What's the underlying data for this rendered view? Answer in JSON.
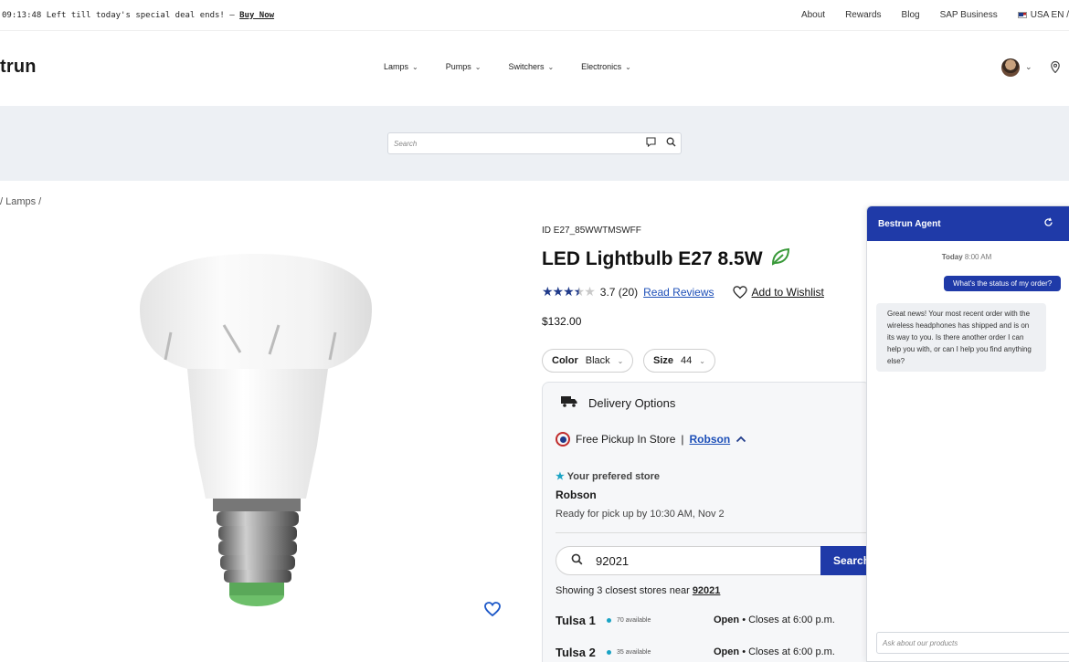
{
  "topbar": {
    "countdown": "09:13:48",
    "promo_text": "Left till today's special deal ends! —",
    "promo_link": "Buy Now",
    "links": [
      "About",
      "Rewards",
      "Blog",
      "SAP Business"
    ],
    "locale": "USA EN /"
  },
  "header": {
    "logo": "trun",
    "nav": [
      "Lamps",
      "Pumps",
      "Switchers",
      "Electronics"
    ]
  },
  "search": {
    "placeholder": "Search"
  },
  "breadcrumb": "/ Lamps /",
  "product": {
    "id_label": "ID E27_85WWTMSWFF",
    "title": "LED Lightbulb E27 8.5W",
    "rating_value": 3.7,
    "rating_text": "3.7 (20)",
    "read_reviews": "Read Reviews",
    "wishlist": "Add to Wishlist",
    "price": "$132.00",
    "color_label": "Color",
    "color_value": "Black",
    "size_label": "Size",
    "size_value": "44"
  },
  "delivery": {
    "title": "Delivery Options",
    "pickup_label": "Free Pickup In Store",
    "pickup_store": "Robson",
    "preferred_label": "Your prefered store",
    "preferred_name": "Robson",
    "ready_text": "Ready for pick up by 10:30 AM, Nov 2",
    "zip_value": "92021",
    "search_button": "Search",
    "showing_prefix": "Showing 3 closest stores near",
    "showing_zip": "92021",
    "stores": [
      {
        "name": "Tulsa 1",
        "available": "70 available",
        "status": "Open",
        "closes": "• Closes at 6:00 p.m."
      },
      {
        "name": "Tulsa 2",
        "available": "35 available",
        "status": "Open",
        "closes": "• Closes at 6:00 p.m."
      }
    ]
  },
  "chat": {
    "title": "Bestrun Agent",
    "time_day": "Today",
    "time_value": "8:00 AM",
    "user_message": "What's the status of my order?",
    "agent_message": "Great news! Your most recent order with the wireless headphones has shipped and is on its way to you. Is there another order I can help you with, or can I help you find anything else?",
    "input_placeholder": "Ask about our products"
  }
}
